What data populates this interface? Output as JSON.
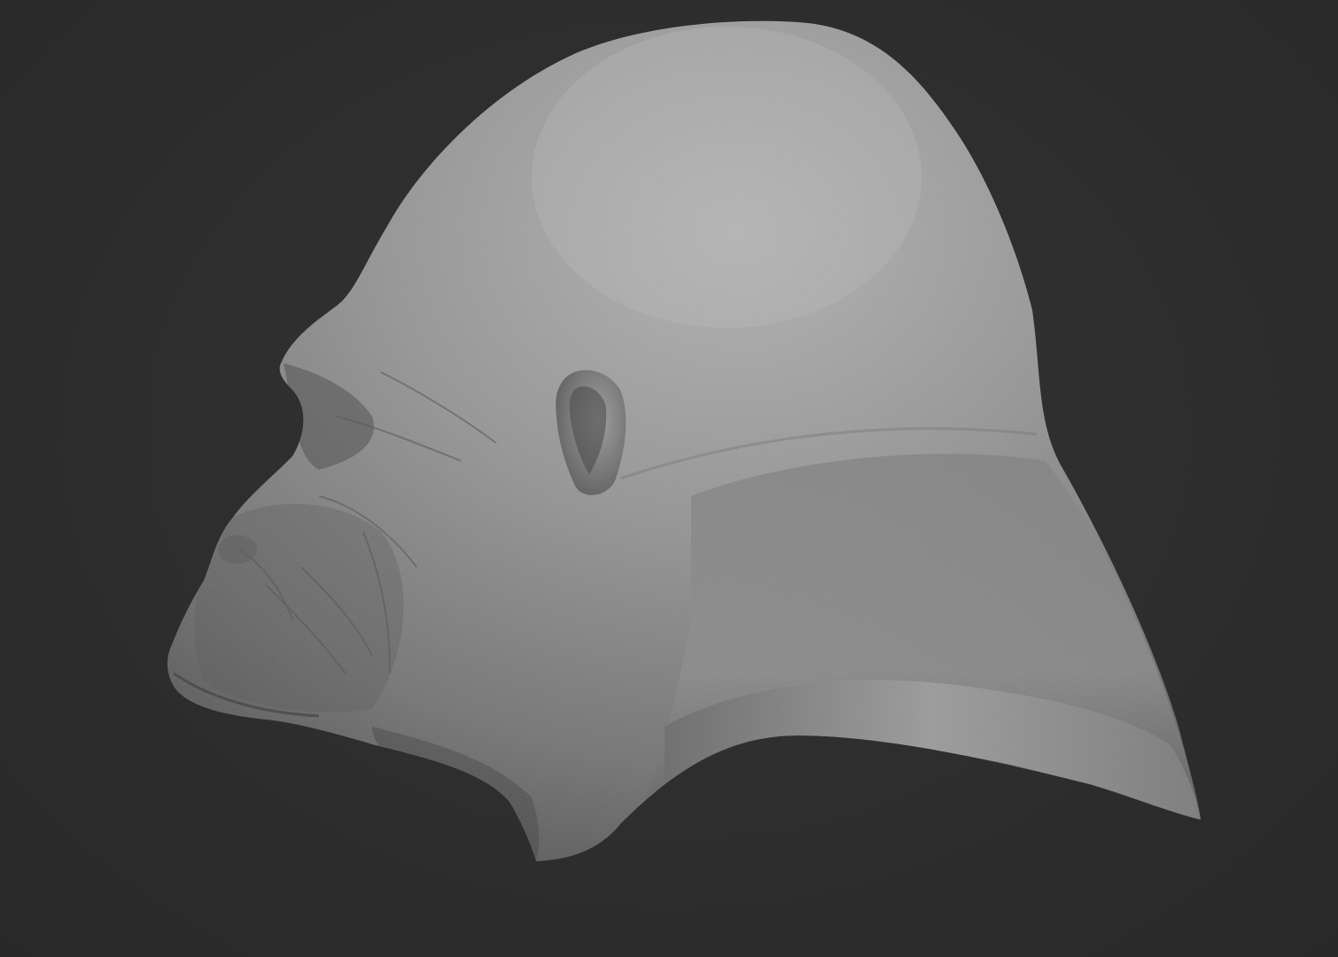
{
  "scene": {
    "subject": "gorilla-head-sculpt",
    "background_color": "#2c2c2c",
    "material_color": "#8a8a8a",
    "highlight_color": "#b4b4b4",
    "shadow_color": "#3a3a3a"
  }
}
